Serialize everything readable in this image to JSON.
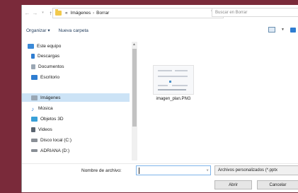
{
  "address": {
    "breadcrumbs": [
      "«",
      "Imágenes",
      "›",
      "Borrar"
    ],
    "search_placeholder": "Buscar en Borrar"
  },
  "toolbar": {
    "organize_label": "Organizar ▾",
    "new_folder_label": "Nueva carpeta"
  },
  "nav": {
    "items": [
      {
        "label": "Este equipo",
        "icon": "computer-icon",
        "color": "#3b8ad8"
      },
      {
        "label": "Descargas",
        "icon": "download-icon",
        "color": "#2f7dd1"
      },
      {
        "label": "Documentos",
        "icon": "documents-icon",
        "color": "#9aa7b4"
      },
      {
        "label": "Escritorio",
        "icon": "desktop-icon",
        "color": "#2f7dd1"
      },
      {
        "label": "Imágenes",
        "icon": "pictures-icon",
        "color": "#9aa7b4",
        "selected": true
      },
      {
        "label": "Música",
        "icon": "music-icon",
        "color": "#2f7dd1"
      },
      {
        "label": "Objetos 3D",
        "icon": "objects-3d-icon",
        "color": "#39a0d8"
      },
      {
        "label": "Videos",
        "icon": "videos-icon",
        "color": "#5a6470"
      },
      {
        "label": "Disco local (C:)",
        "icon": "drive-icon",
        "color": "#8a8f96"
      },
      {
        "label": "ADRIANA (D:)",
        "icon": "usb-drive-icon",
        "color": "#8a8f96"
      }
    ]
  },
  "files": [
    {
      "name": "imagen_plan.PNG"
    }
  ],
  "bottom": {
    "filename_label": "Nombre de archivo:",
    "filename_value": "",
    "filter_label": "Archivos personalizados (*.pptx",
    "open_label": "Abrir",
    "cancel_label": "Cancelar"
  }
}
